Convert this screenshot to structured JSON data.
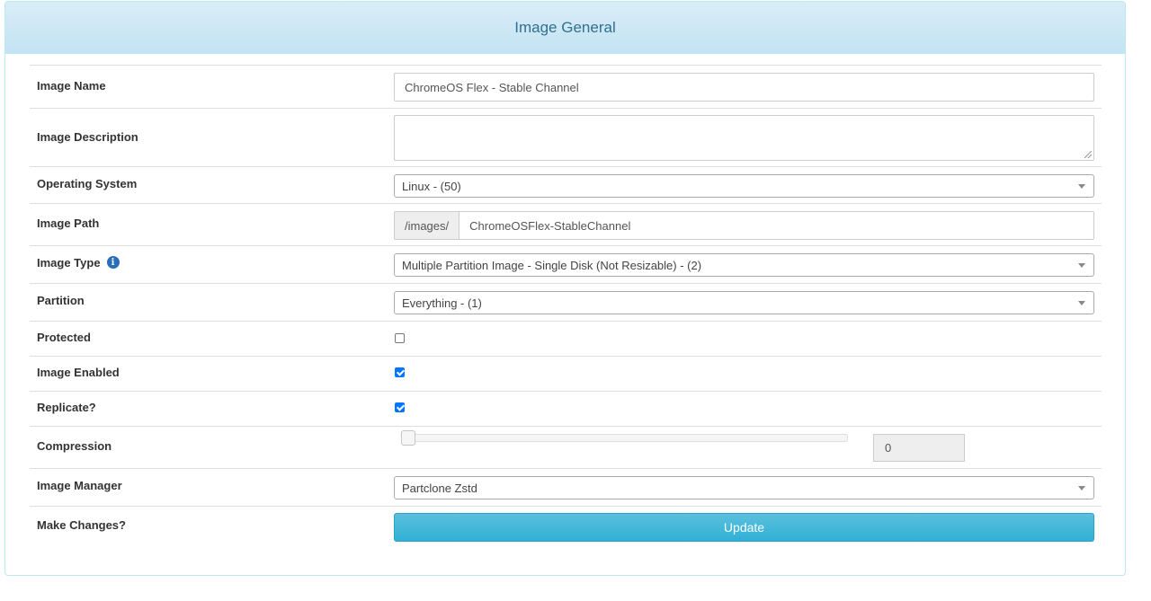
{
  "panel": {
    "title": "Image General"
  },
  "fields": {
    "image_name": {
      "label": "Image Name",
      "value": "ChromeOS Flex - Stable Channel"
    },
    "image_description": {
      "label": "Image Description",
      "value": ""
    },
    "operating_system": {
      "label": "Operating System",
      "selected": "Linux - (50)"
    },
    "image_path": {
      "label": "Image Path",
      "prefix": "/images/",
      "value": "ChromeOSFlex-StableChannel"
    },
    "image_type": {
      "label": "Image Type",
      "info_icon": "info-circle-icon",
      "selected": "Multiple Partition Image - Single Disk (Not Resizable) - (2)"
    },
    "partition": {
      "label": "Partition",
      "selected": "Everything - (1)"
    },
    "protected": {
      "label": "Protected",
      "checked": false
    },
    "image_enabled": {
      "label": "Image Enabled",
      "checked": true
    },
    "replicate": {
      "label": "Replicate?",
      "checked": true
    },
    "compression": {
      "label": "Compression",
      "value": "0",
      "slider_fraction": 0
    },
    "image_manager": {
      "label": "Image Manager",
      "selected": "Partclone Zstd"
    },
    "make_changes": {
      "label": "Make Changes?",
      "button_label": "Update"
    }
  },
  "colors": {
    "heading_text": "#31708f",
    "heading_bg": "#d9edf7",
    "button_bg": "#31b0d5",
    "checkbox_checked": "#0075ff",
    "info_icon": "#2a6ebb"
  }
}
